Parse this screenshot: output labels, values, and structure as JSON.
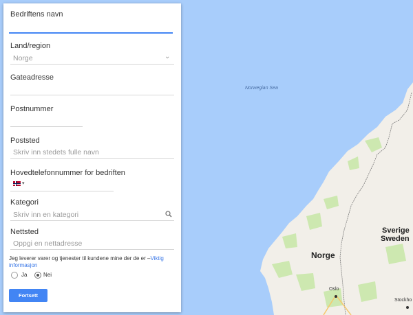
{
  "form": {
    "business_name": {
      "label": "Bedriftens navn",
      "value": ""
    },
    "country": {
      "label": "Land/region",
      "value": "Norge"
    },
    "street": {
      "label": "Gateadresse",
      "value": ""
    },
    "postal_code": {
      "label": "Postnummer",
      "value": ""
    },
    "postal_place": {
      "label": "Poststed",
      "placeholder": "Skriv inn stedets fulle navn"
    },
    "phone": {
      "label": "Hovedtelefonnummer for bedriften",
      "value": ""
    },
    "category": {
      "label": "Kategori",
      "placeholder": "Skriv inn en kategori"
    },
    "website": {
      "label": "Nettsted",
      "placeholder": "Oppgi en nettadresse"
    },
    "delivery_question": "Jeg leverer varer og tjenester til kundene mine der de er –",
    "delivery_link": "Viktig informasjon",
    "options": [
      {
        "label": "Ja",
        "selected": false
      },
      {
        "label": "Nei",
        "selected": true
      }
    ],
    "continue_button": "Fortsett"
  },
  "map": {
    "sea_label": "Norwegian Sea",
    "country_label_1": "Norge",
    "country_label_2a": "Sverige",
    "country_label_2b": "Sweden",
    "city_1": "Oslo",
    "city_2": "Stockho"
  },
  "colors": {
    "water": "#a8cdfb",
    "land": "#f2efe9",
    "forest": "#cde8b0",
    "accent": "#4285f4",
    "link": "#3b78e7"
  }
}
